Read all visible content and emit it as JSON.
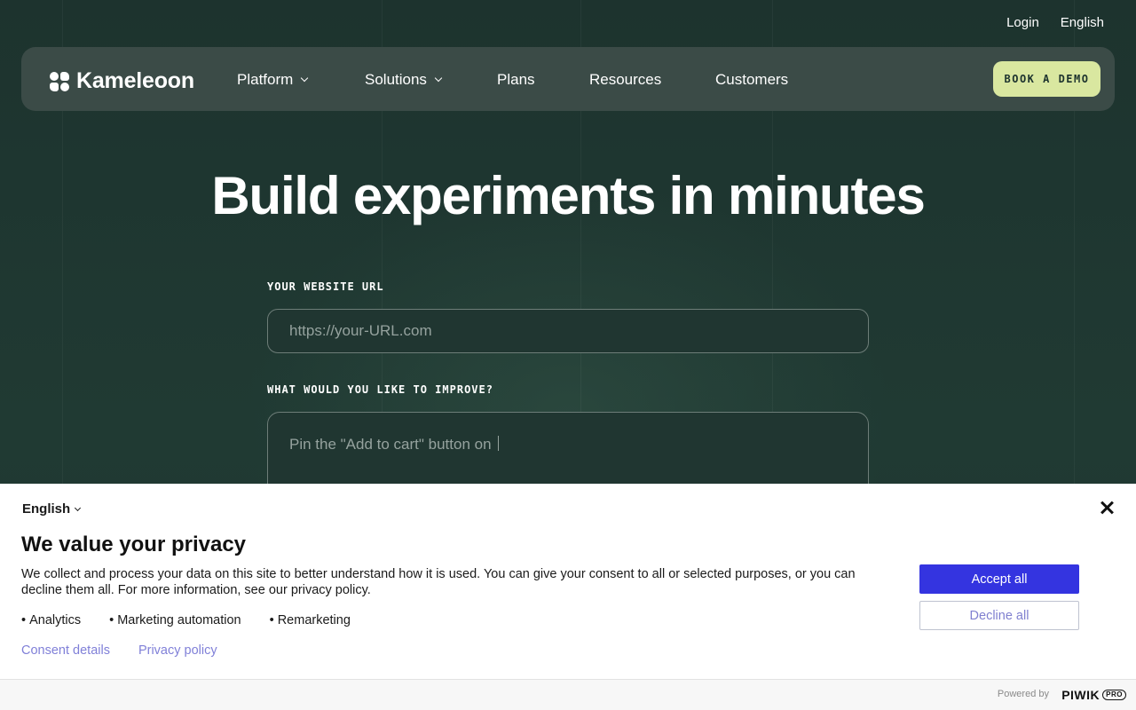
{
  "topbar": {
    "login": "Login",
    "language": "English"
  },
  "nav": {
    "logo_text": "Kameleoon",
    "items": [
      {
        "label": "Platform"
      },
      {
        "label": "Solutions"
      },
      {
        "label": "Plans"
      },
      {
        "label": "Resources"
      },
      {
        "label": "Customers"
      }
    ],
    "cta": "BOOK A DEMO"
  },
  "hero": {
    "title": "Build experiments in minutes",
    "url_label": "YOUR WEBSITE URL",
    "url_placeholder": "https://your-URL.com",
    "improve_label": "WHAT WOULD YOU LIKE TO IMPROVE?",
    "improve_text": "Pin the \"Add to cart\" button on"
  },
  "consent": {
    "language": "English",
    "title": "We value your privacy",
    "body": "We collect and process your data on this site to better understand how it is used. You can give your consent to all or selected purposes, or you can decline them all. For more information, see our privacy policy.",
    "purposes": [
      "Analytics",
      "Marketing automation",
      "Remarketing"
    ],
    "links": {
      "details": "Consent details",
      "privacy": "Privacy policy"
    },
    "accept": "Accept all",
    "decline": "Decline all",
    "powered_by": "Powered by",
    "vendor": "PIWIK",
    "vendor_badge": "PRO"
  },
  "colors": {
    "page_bg": "#1e3530",
    "nav_bg": "#3b4b47",
    "cta_bg": "#d9e7a0",
    "accept_bg": "#3434e0",
    "link": "#8080d8"
  }
}
